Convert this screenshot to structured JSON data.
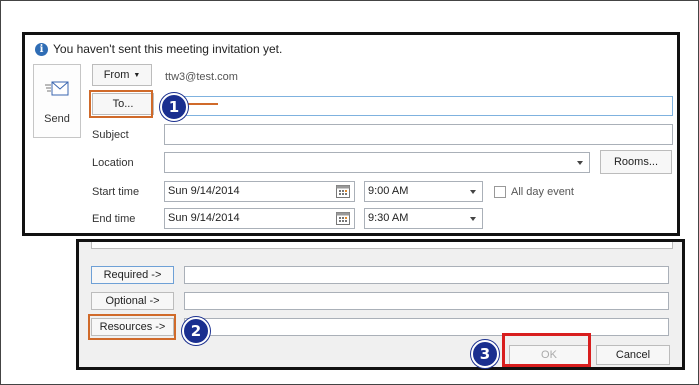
{
  "info_bar": {
    "text": "You haven't sent this meeting invitation yet."
  },
  "send": {
    "label": "Send"
  },
  "from": {
    "label": "From",
    "value": "ttw3@test.com"
  },
  "to": {
    "label": "To..."
  },
  "subject": {
    "label": "Subject"
  },
  "location": {
    "label": "Location",
    "rooms_label": "Rooms..."
  },
  "start": {
    "label": "Start time",
    "date": "Sun 9/14/2014",
    "time": "9:00 AM"
  },
  "end": {
    "label": "End time",
    "date": "Sun 9/14/2014",
    "time": "9:30 AM"
  },
  "all_day": {
    "label": "All day event"
  },
  "dialog": {
    "required_label": "Required ->",
    "optional_label": "Optional ->",
    "resources_label": "Resources ->",
    "ok_label": "OK",
    "cancel_label": "Cancel"
  },
  "callouts": [
    "1",
    "2",
    "3"
  ],
  "colors": {
    "highlight_orange": "#d06a2a",
    "highlight_red": "#d81e1e",
    "callout_blue": "#1a2f8f"
  }
}
